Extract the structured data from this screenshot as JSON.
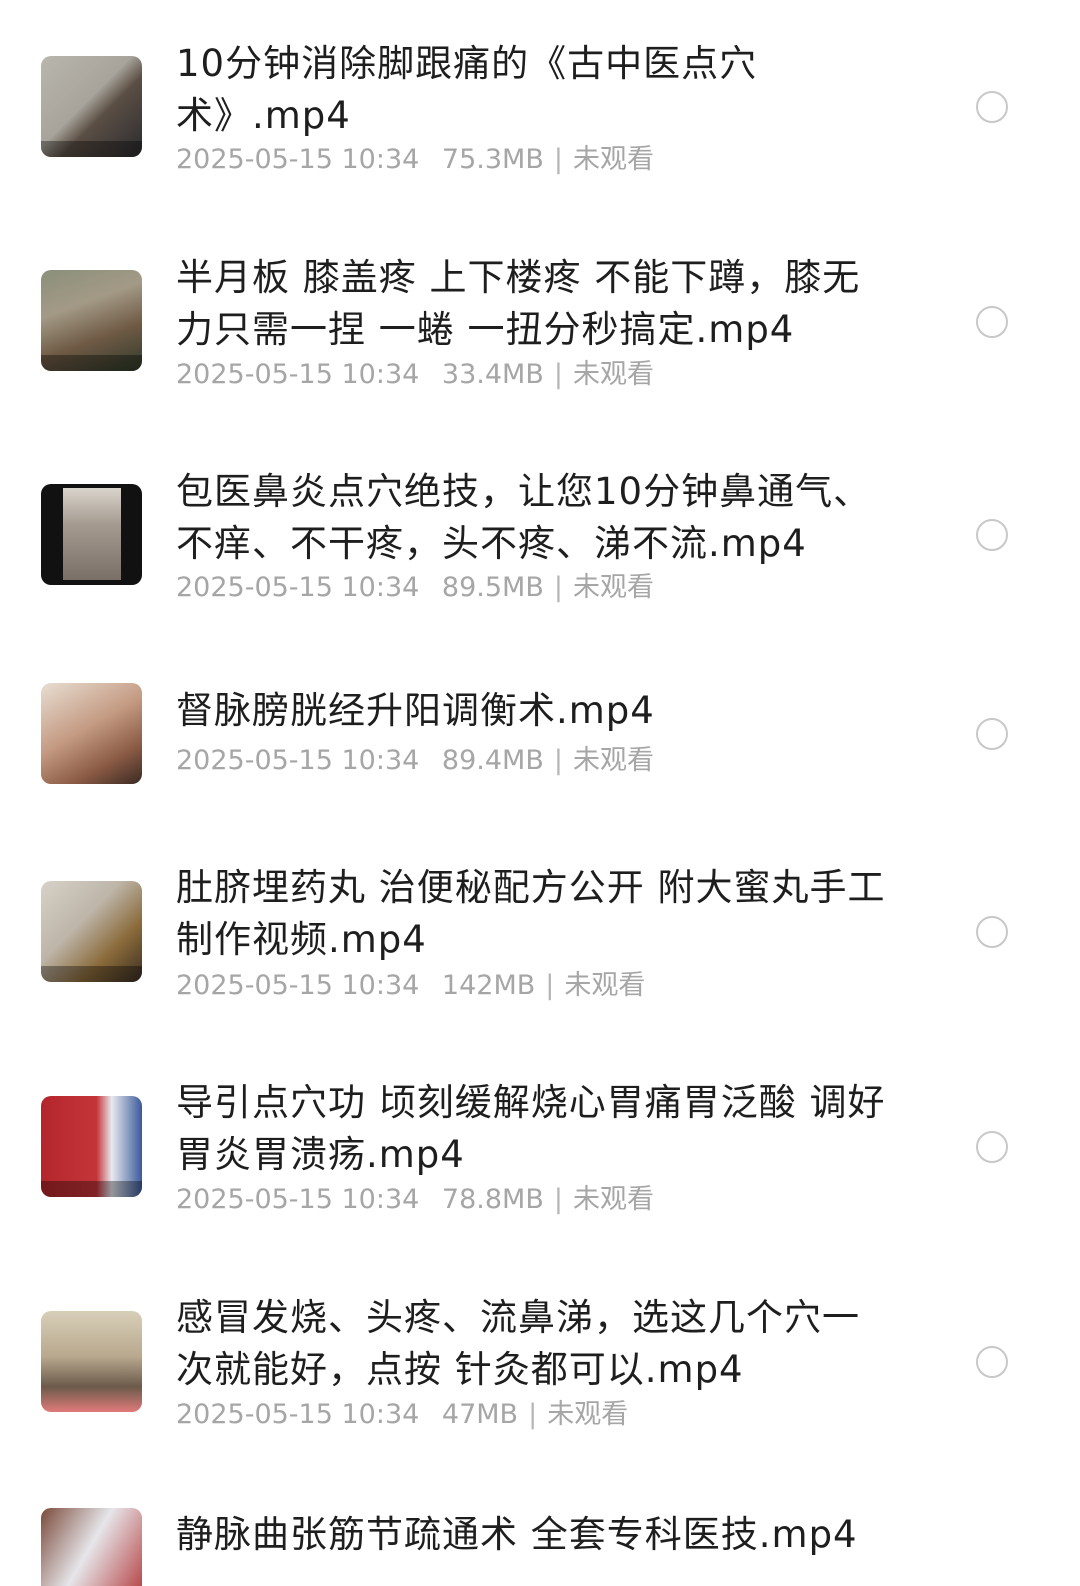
{
  "files": [
    {
      "title": "10分钟消除脚跟痛的《古中医点穴术》.mp4",
      "date": "2025-05-15 10:34",
      "size": "75.3MB",
      "status": "未观看",
      "thumb_colors": [
        "#b9b6ae",
        "#5a4e44",
        "#2b2b30"
      ]
    },
    {
      "title": "半月板 膝盖疼 上下楼疼 不能下蹲，膝无力只需一捏 一蜷  一扭分秒搞定.mp4",
      "date": "2025-05-15 10:34",
      "size": "33.4MB",
      "status": "未观看",
      "thumb_colors": [
        "#8a8f7a",
        "#6f5a45",
        "#2f3a2a"
      ]
    },
    {
      "title": "包医鼻炎点穴绝技，让您10分钟鼻通气、不痒、不干疼，头不疼、涕不流.mp4",
      "date": "2025-05-15 10:34",
      "size": "89.5MB",
      "status": "未观看",
      "thumb_colors": [
        "#111111",
        "#d9d4cc",
        "#7a6f66"
      ]
    },
    {
      "title": "督脉膀胱经升阳调衡术.mp4",
      "date": "2025-05-15 10:34",
      "size": "89.4MB",
      "status": "未观看",
      "thumb_colors": [
        "#c49a82",
        "#e8ded2",
        "#3a2a22"
      ]
    },
    {
      "title": "肚脐埋药丸 治便秘配方公开 附大蜜丸手工制作视频.mp4",
      "date": "2025-05-15 10:34",
      "size": "142MB",
      "status": "未观看",
      "thumb_colors": [
        "#d7d2c8",
        "#8a6a3a",
        "#3a2e24"
      ]
    },
    {
      "title": "导引点穴功 顷刻缓解烧心胃痛胃泛酸 调好胃炎胃溃疡.mp4",
      "date": "2025-05-15 10:34",
      "size": "78.8MB",
      "status": "未观看",
      "thumb_colors": [
        "#b3262c",
        "#e7e9ef",
        "#3a5a9a"
      ]
    },
    {
      "title": "感冒发烧、头疼、流鼻涕，选这几个穴一次就能好，点按 针灸都可以.mp4",
      "date": "2025-05-15 10:34",
      "size": "47MB",
      "status": "未观看",
      "thumb_colors": [
        "#d8cfb8",
        "#6b5a4a",
        "#e07a7a"
      ]
    },
    {
      "title": "静脉曲张筋节疏通术  全套专科医技.mp4",
      "date": "",
      "size": "",
      "status": "",
      "thumb_colors": [
        "#7a4a3a",
        "#e6e6ea",
        "#b03030"
      ]
    }
  ]
}
